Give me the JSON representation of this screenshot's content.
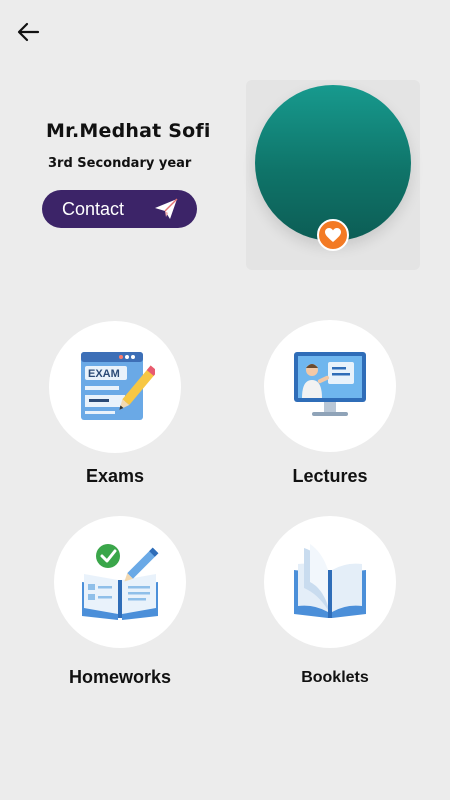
{
  "header": {
    "back_icon": "arrow-left-icon"
  },
  "profile": {
    "name": "Mr.Medhat Sofi",
    "grade": "3rd Secondary year",
    "contact_label": "Contact",
    "contact_icon": "paper-plane-icon",
    "favorite_icon": "heart-icon",
    "avatar_color": "#127f74",
    "favorite_color": "#f37a24",
    "button_color": "#3c2468"
  },
  "menu": {
    "exams": "Exams",
    "lectures": "Lectures",
    "homeworks": "Homeworks",
    "booklets": "Booklets"
  }
}
